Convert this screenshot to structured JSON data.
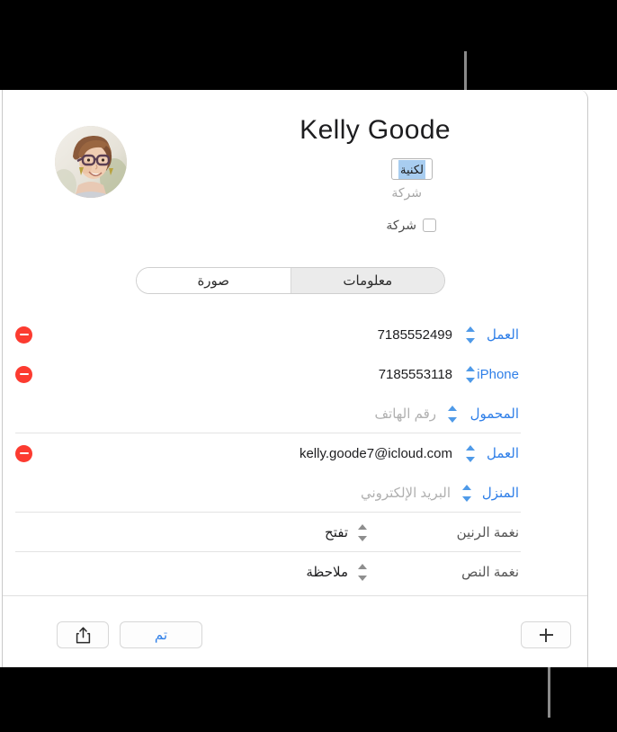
{
  "window": {
    "contact_name": "Kelly  Goode"
  },
  "header": {
    "lastname_field_value": "لكنية",
    "company_placeholder": "شركة",
    "company_checkbox_label": "شركة",
    "avatar_alt": "contact-photo"
  },
  "tabs": [
    {
      "label": "صورة",
      "active": false
    },
    {
      "label": "معلومات",
      "active": true
    }
  ],
  "fields": [
    {
      "label": "العمل",
      "value": "7185552499",
      "kind": "phone",
      "removable": true,
      "placeholder": false,
      "separator": false
    },
    {
      "label": "iPhone",
      "value": "7185553118",
      "kind": "phone",
      "removable": true,
      "placeholder": false,
      "separator": false
    },
    {
      "label": "المحمول",
      "value": "رقم الهاتف",
      "kind": "phone",
      "removable": false,
      "placeholder": true,
      "separator": true
    },
    {
      "label": "العمل",
      "value": "kelly.goode7@icloud.com",
      "kind": "email",
      "removable": true,
      "placeholder": false,
      "separator": false
    },
    {
      "label": "المنزل",
      "value": "البريد الإلكتروني",
      "kind": "email",
      "removable": false,
      "placeholder": true,
      "separator": true
    },
    {
      "label": "نغمة الرنين",
      "value": "تفتح",
      "kind": "ringtone",
      "removable": false,
      "placeholder": false,
      "separator": true
    },
    {
      "label": "نغمة النص",
      "value": "ملاحظة",
      "kind": "texttone",
      "removable": false,
      "placeholder": false,
      "separator": false
    }
  ],
  "toolbar": {
    "share_icon": "share-icon",
    "done_label": "تم",
    "add_icon": "plus-icon"
  },
  "colors": {
    "accent_blue": "#2f7fe8",
    "stepper_blue": "#4f9ae8",
    "remove_red": "#fc3b30",
    "selection_blue": "#a8cdf0",
    "placeholder_grey": "#b0b0b0",
    "band_black": "#000000",
    "leader_grey": "#8a8a8a"
  }
}
